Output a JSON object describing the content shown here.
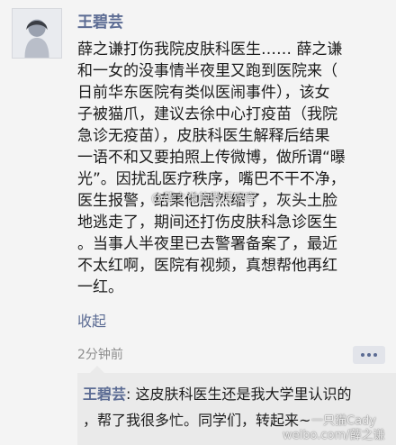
{
  "post": {
    "username": "王碧芸",
    "lines": [
      "薛之谦打伤我院皮肤科医生…… 薛之谦",
      "和一女的没事情半夜里又跑到医院来（",
      "日前华东医院有类似医闹事件），该女",
      "子被猫爪，建议去徐中心打疫苗（我院",
      "急诊无疫苗），皮肤科医生解释后结果",
      "一语不和又要拍照上传微博，做所谓“曝",
      "光”。因扰乱医疗秩序，嘴巴不干不净，",
      "医生报警，结果他居然缩了，灰头土脸",
      "地逃走了，期间还打伤皮肤科急诊医生",
      "。当事人半夜里已去警署备案了，最近",
      "不太红啊，医院有视频，真想帮他再红",
      "一红。"
    ],
    "collapse_label": "收起",
    "timestamp": "2分钟前"
  },
  "comment": {
    "author": "王碧芸",
    "separator": ": ",
    "line1_text": "这皮肤科医生还是我大学里认识的",
    "line2_text": "，帮了我很多忙。同学们，转起来~"
  },
  "watermarks": {
    "middle": "@薛之谦的微博观察",
    "bottom_line1": "一只猫Cady",
    "bottom_line2": "weibo.com/薛之谦"
  }
}
